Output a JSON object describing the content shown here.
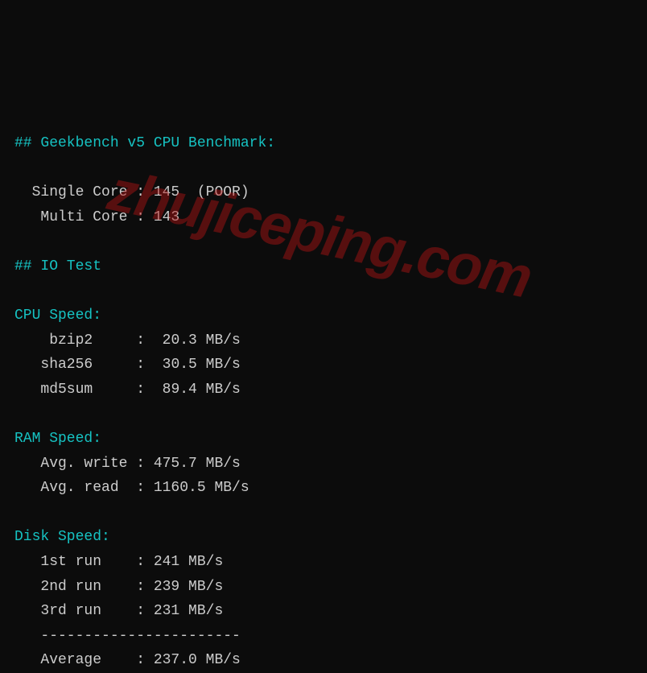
{
  "watermark": "zhujiceping.com",
  "geekbench": {
    "header": "## Geekbench v5 CPU Benchmark:",
    "single_core_label": "  Single Core : ",
    "single_core_value": "145  (POOR)",
    "multi_core_label": "   Multi Core : ",
    "multi_core_value": "143"
  },
  "io_test": {
    "header": "## IO Test"
  },
  "cpu_speed": {
    "header": "CPU Speed:",
    "bzip2_label": "    bzip2     :  ",
    "bzip2_value": "20.3 MB/s",
    "sha256_label": "   sha256     :  ",
    "sha256_value": "30.5 MB/s",
    "md5sum_label": "   md5sum     :  ",
    "md5sum_value": "89.4 MB/s"
  },
  "ram_speed": {
    "header": "RAM Speed:",
    "write_label": "   Avg. write : ",
    "write_value": "475.7 MB/s",
    "read_label": "   Avg. read  : ",
    "read_value": "1160.5 MB/s"
  },
  "disk_speed": {
    "header": "Disk Speed:",
    "run1_label": "   1st run    : ",
    "run1_value": "241 MB/s",
    "run2_label": "   2nd run    : ",
    "run2_value": "239 MB/s",
    "run3_label": "   3rd run    : ",
    "run3_value": "231 MB/s",
    "divider": "   -----------------------",
    "avg_label": "   Average    : ",
    "avg_value": "237.0 MB/s"
  }
}
